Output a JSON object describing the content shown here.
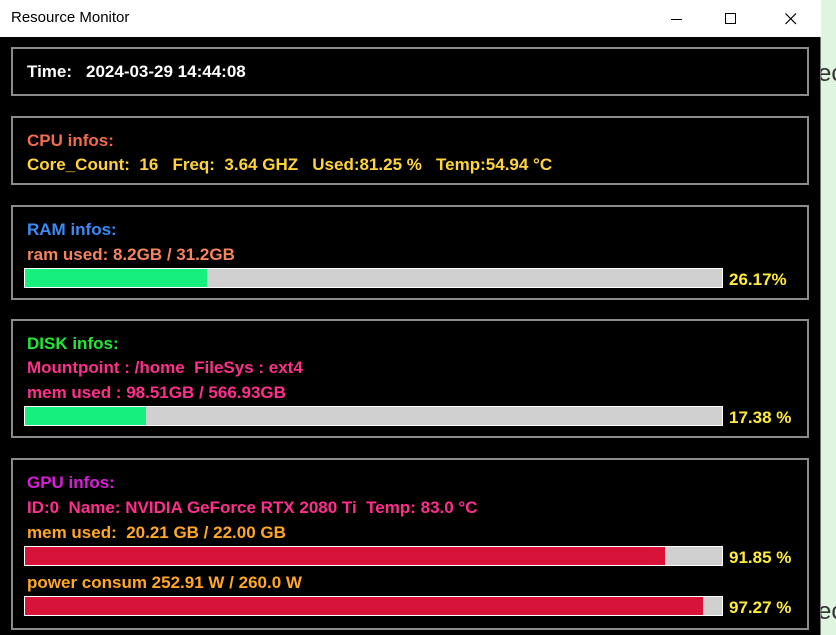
{
  "window": {
    "title": "Resource Monitor"
  },
  "time": {
    "label": "Time:",
    "value": "2024-03-29 14:44:08"
  },
  "cpu": {
    "heading": "CPU infos:",
    "line": "Core_Count:  16   Freq:  3.64 GHZ   Used:81.25 %   Temp:54.94 °C"
  },
  "ram": {
    "heading": "RAM infos:",
    "used": "ram used: 8.2GB / 31.2GB",
    "percent_label": "26.17%",
    "percent": 26.17
  },
  "disk": {
    "heading": "DISK infos:",
    "mount": "Mountpoint : /home  FileSys : ext4",
    "used": "mem used : 98.51GB / 566.93GB",
    "percent_label": "17.38 %",
    "percent": 17.38
  },
  "gpu": {
    "heading": "GPU infos:",
    "info": "ID:0  Name: NVIDIA GeForce RTX 2080 Ti  Temp: 83.0 °C",
    "mem_used": "mem used:  20.21 GB / 22.00 GB",
    "mem_percent_label": "91.85 %",
    "mem_percent": 91.85,
    "power": "power consum 252.91 W / 260.0 W",
    "power_percent_label": "97.27 %",
    "power_percent": 97.27
  },
  "colors": {
    "cpu_heading": "#f26b4b",
    "cpu_line": "#ffd43b",
    "ram_heading": "#3d8af7",
    "ram_used": "#f5845e",
    "disk_heading": "#22e83a",
    "disk_text": "#ff2f8c",
    "gpu_heading": "#d81fd8",
    "gpu_info": "#ff2f8c",
    "gpu_text": "#ffa726",
    "fill_green": "#16ee7e",
    "fill_red": "#d8133a"
  },
  "background_text": [
    "ec",
    "ec"
  ]
}
